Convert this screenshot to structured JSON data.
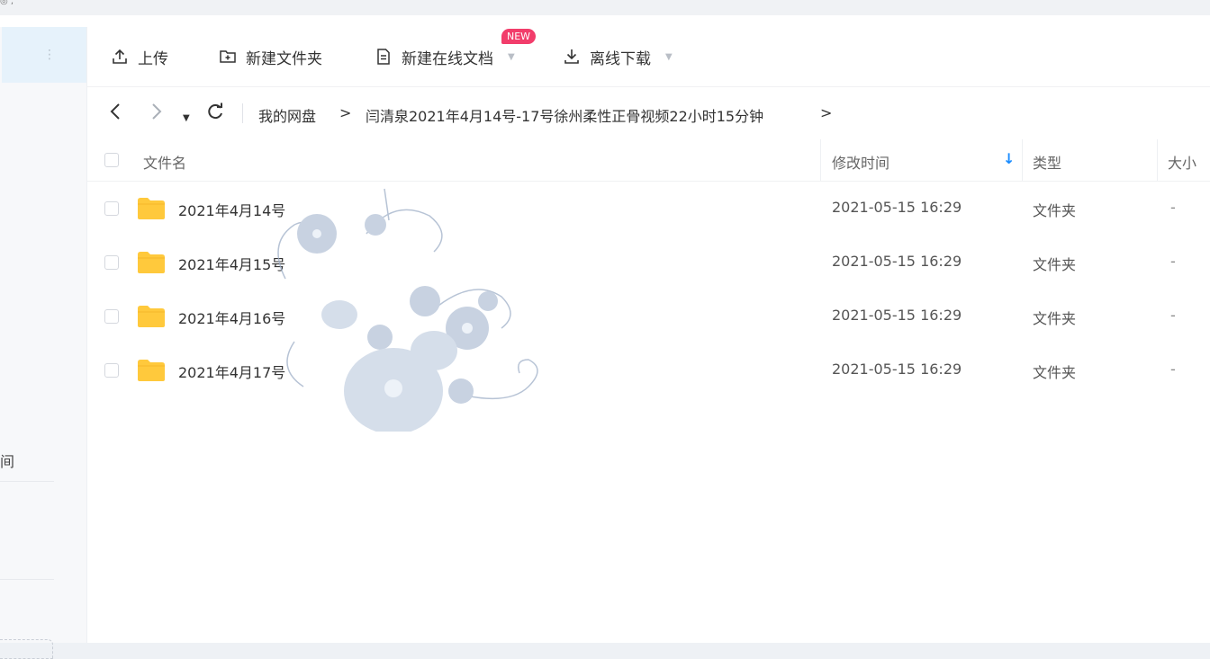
{
  "toolbar": {
    "upload_label": "上传",
    "new_folder_label": "新建文件夹",
    "new_doc_label": "新建在线文档",
    "new_badge": "NEW",
    "offline_download_label": "离线下载"
  },
  "breadcrumb": {
    "root": "我的网盘",
    "current": "闫清泉2021年4月14号-17号徐州柔性正骨视频22小时15分钟",
    "separator": ">"
  },
  "table": {
    "columns": {
      "name": "文件名",
      "modified": "修改时间",
      "type": "类型",
      "size": "大小"
    },
    "rows": [
      {
        "name": "2021年4月14号",
        "modified": "2021-05-15 16:29",
        "type": "文件夹",
        "size": "-"
      },
      {
        "name": "2021年4月15号",
        "modified": "2021-05-15 16:29",
        "type": "文件夹",
        "size": "-"
      },
      {
        "name": "2021年4月16号",
        "modified": "2021-05-15 16:29",
        "type": "文件夹",
        "size": "-"
      },
      {
        "name": "2021年4月17号",
        "modified": "2021-05-15 16:29",
        "type": "文件夹",
        "size": "-"
      }
    ]
  },
  "sidebar": {
    "partial_label": "间"
  },
  "colors": {
    "accent": "#1a8cff",
    "badge": "#f23d6b",
    "folder": "#ffc93c",
    "active_bg": "#e6f2fb"
  },
  "icons": {
    "upload": "upload-icon",
    "new_folder": "folder-plus-icon",
    "new_doc": "document-icon",
    "offline_download": "download-icon",
    "back": "chevron-left-icon",
    "forward": "chevron-right-icon",
    "history": "caret-down-icon",
    "refresh": "refresh-icon",
    "sort": "arrow-down-icon",
    "folder": "folder-icon"
  }
}
